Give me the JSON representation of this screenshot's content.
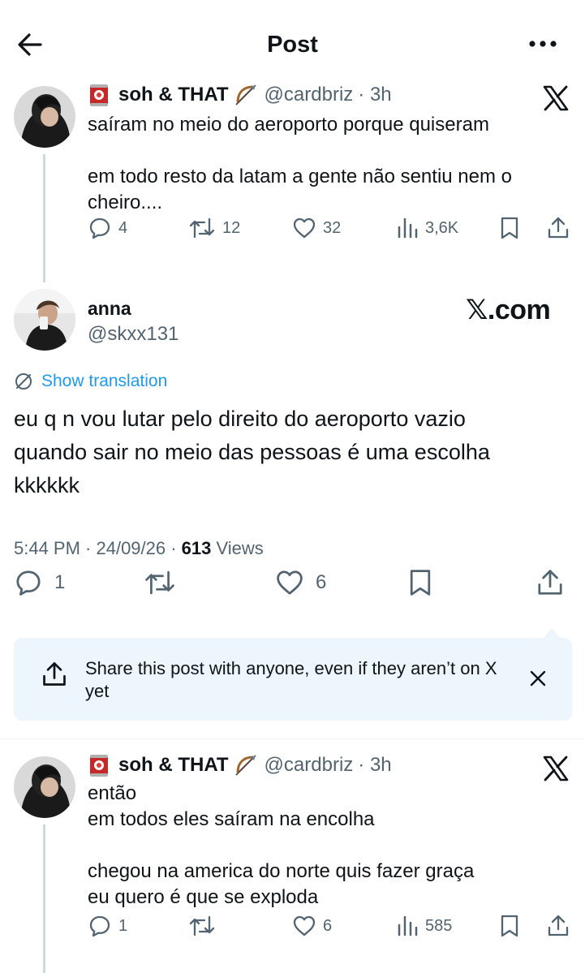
{
  "header": {
    "title": "Post",
    "back_icon": "arrow-left-icon",
    "more_icon": "more-horizontal-icon"
  },
  "colors": {
    "accent": "#1d9bf0",
    "secondary_text": "#536471",
    "share_bg": "#edf6fd"
  },
  "tweet1": {
    "name": "soh & THAT",
    "handle": "@cardbriz",
    "time": "· 3h",
    "text": "saíram no meio do aeroporto porque quiseram\n\nem todo resto da latam a gente não sentiu nem o cheiro....",
    "replies": "4",
    "retweets": "12",
    "likes": "32",
    "views": "3,6K"
  },
  "main": {
    "name": "anna",
    "handle": "@skxx131",
    "watermark": "𝕏.com",
    "translate_label": "Show translation",
    "text": "eu q n vou lutar pelo direito do aeroporto vazio\nquando sair no meio das pessoas é uma escolha\nkkkkkk",
    "time": "5:44 PM · 24/09/26 · ",
    "views_count": "613",
    "views_label": " Views",
    "replies": "1",
    "likes": "6"
  },
  "share_banner": {
    "text": "Share this post with anyone, even if they aren’t on X yet"
  },
  "tweet2": {
    "name": "soh & THAT",
    "handle": "@cardbriz",
    "time": "· 3h",
    "text": "então\nem todos eles saíram na encolha\n\nchegou na america do norte quis fazer graça\neu quero é que se exploda",
    "replies": "1",
    "likes": "6",
    "views": "585"
  }
}
